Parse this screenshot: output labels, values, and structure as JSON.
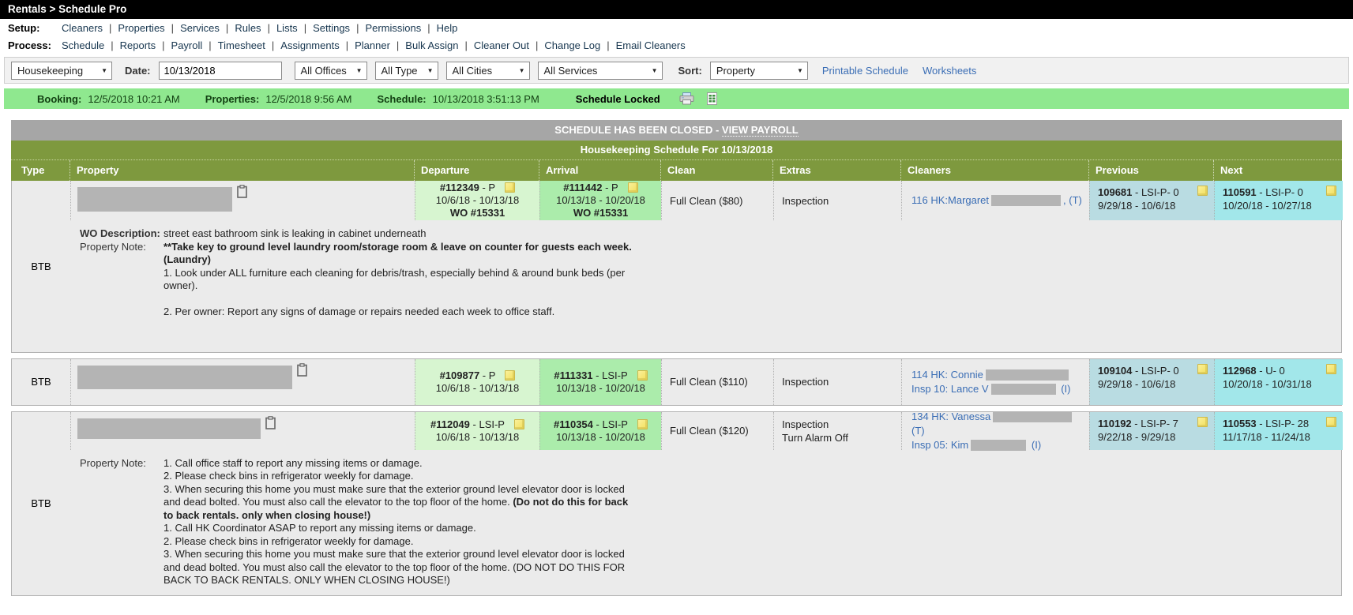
{
  "titlebar": {
    "breadcrumb": "Rentals > Schedule Pro"
  },
  "nav": {
    "setup_label": "Setup:",
    "setup_items": [
      "Cleaners",
      "Properties",
      "Services",
      "Rules",
      "Lists",
      "Settings",
      "Permissions",
      "Help"
    ],
    "process_label": "Process:",
    "process_items": [
      "Schedule",
      "Reports",
      "Payroll",
      "Timesheet",
      "Assignments",
      "Planner",
      "Bulk Assign",
      "Cleaner Out",
      "Change Log",
      "Email Cleaners"
    ]
  },
  "filters": {
    "category_select": "Housekeeping",
    "date_label": "Date:",
    "date_value": "10/13/2018",
    "offices_select": "All Offices",
    "type_select": "All Type",
    "cities_select": "All Cities",
    "services_select": "All Services",
    "sort_label": "Sort:",
    "sort_select": "Property",
    "printable_link": "Printable Schedule",
    "worksheets_link": "Worksheets"
  },
  "statusbar": {
    "booking_label": "Booking:",
    "booking_value": "12/5/2018 10:21 AM",
    "properties_label": "Properties:",
    "properties_value": "12/5/2018 9:56 AM",
    "schedule_label": "Schedule:",
    "schedule_value": "10/13/2018 3:51:13 PM",
    "locked_text": "Schedule Locked",
    "icons": {
      "printer": "printer-icon",
      "excel_export": "excel-export-icon"
    }
  },
  "banner": {
    "closed_prefix": "SCHEDULE HAS BEEN CLOSED - ",
    "closed_link": "VIEW PAYROLL",
    "subtitle": "Housekeeping Schedule For 10/13/2018"
  },
  "colors": {
    "header_olive": "#7e993e",
    "status_green": "#8fe88f",
    "closed_gray": "#a6a6a6",
    "departure_bg": "#d7f5d0",
    "arrival_bg": "#abecab",
    "previous_bg": "#b9dce2",
    "next_bg": "#a2e7ea",
    "link_blue": "#3b6eb5"
  },
  "table": {
    "headers": [
      "Type",
      "Property",
      "Departure",
      "Arrival",
      "Clean",
      "Extras",
      "Cleaners",
      "Previous",
      "Next"
    ],
    "rows": [
      {
        "type": "BTB",
        "departure": {
          "num": "#112349",
          "suffix": " - P",
          "dates": "10/6/18 - 10/13/18",
          "wo": "WO #15331"
        },
        "arrival": {
          "num": "#111442",
          "suffix": " - P",
          "dates": "10/13/18 - 10/20/18",
          "wo": "WO #15331"
        },
        "clean": "Full Clean ($80)",
        "extras": "Inspection",
        "cleaners": {
          "line1_prefix": "116 HK:Margaret",
          "line1_suffix": ", (T)"
        },
        "previous": {
          "num": "109681",
          "suffix": " - LSI-P- 0",
          "dates": "9/29/18 - 10/6/18"
        },
        "next": {
          "num": "110591",
          "suffix": " - LSI-P- 0",
          "dates": "10/20/18 - 10/27/18"
        },
        "notes": {
          "wo_label": "WO Description:",
          "wo_text": "street east bathroom sink is leaking in cabinet underneath",
          "note_label": "Property Note:",
          "note_bold": "**Take key to ground level laundry room/storage room & leave on counter for guests each week.\n(Laundry)",
          "note_body": "\n1. Look under ALL furniture each cleaning for debris/trash, especially behind & around bunk beds (per\nowner).\n\n2. Per owner: Report any signs of damage or repairs needed each week to office staff."
        }
      },
      {
        "type": "BTB",
        "departure": {
          "num": "#109877",
          "suffix": " - P",
          "dates": "10/6/18 - 10/13/18"
        },
        "arrival": {
          "num": "#111331",
          "suffix": " - LSI-P",
          "dates": "10/13/18 - 10/20/18"
        },
        "clean": "Full Clean ($110)",
        "extras": "Inspection",
        "cleaners": {
          "line1_prefix": "114 HK: Connie",
          "line2_prefix": "Insp 10: Lance V",
          "line2_suffix": " (I)"
        },
        "previous": {
          "num": "109104",
          "suffix": " - LSI-P- 0",
          "dates": "9/29/18 - 10/6/18"
        },
        "next": {
          "num": "112968",
          "suffix": " - U- 0",
          "dates": "10/20/18 - 10/31/18"
        }
      },
      {
        "type": "BTB",
        "departure": {
          "num": "#112049",
          "suffix": " - LSI-P",
          "dates": "10/6/18 - 10/13/18"
        },
        "arrival": {
          "num": "#110354",
          "suffix": " - LSI-P",
          "dates": "10/13/18 - 10/20/18"
        },
        "clean": "Full Clean ($120)",
        "extras": "Inspection\nTurn Alarm Off",
        "cleaners": {
          "line1_prefix": "134 HK: Vanessa",
          "line1_suffix": " (T)",
          "line2_prefix": "Insp 05: Kim",
          "line2_suffix": " (I)"
        },
        "previous": {
          "num": "110192",
          "suffix": " - LSI-P- 7",
          "dates": "9/22/18 - 9/29/18"
        },
        "next": {
          "num": "110553",
          "suffix": " - LSI-P- 28",
          "dates": "11/17/18 - 11/24/18"
        },
        "notes": {
          "note_label": "Property Note:",
          "note_part1": "1. Call office staff to report any missing items or damage.\n2. Please check bins in refrigerator weekly for damage.\n3. When securing this home you must make sure that the exterior ground level elevator door is locked\nand dead bolted. You must also call the elevator to the top floor of the home. ",
          "note_bold": "(Do not do this for back\nto back rentals. only when closing house!)",
          "note_part2": "\n1. Call HK Coordinator ASAP to report any missing items or damage.\n2. Please check bins in refrigerator weekly for damage.\n3. When securing this home you must make sure that the exterior ground level elevator door is locked\nand dead bolted. You must also call the elevator to the top floor of the home. (DO NOT DO THIS FOR\nBACK TO BACK RENTALS. ONLY WHEN CLOSING HOUSE!)"
        }
      }
    ]
  }
}
